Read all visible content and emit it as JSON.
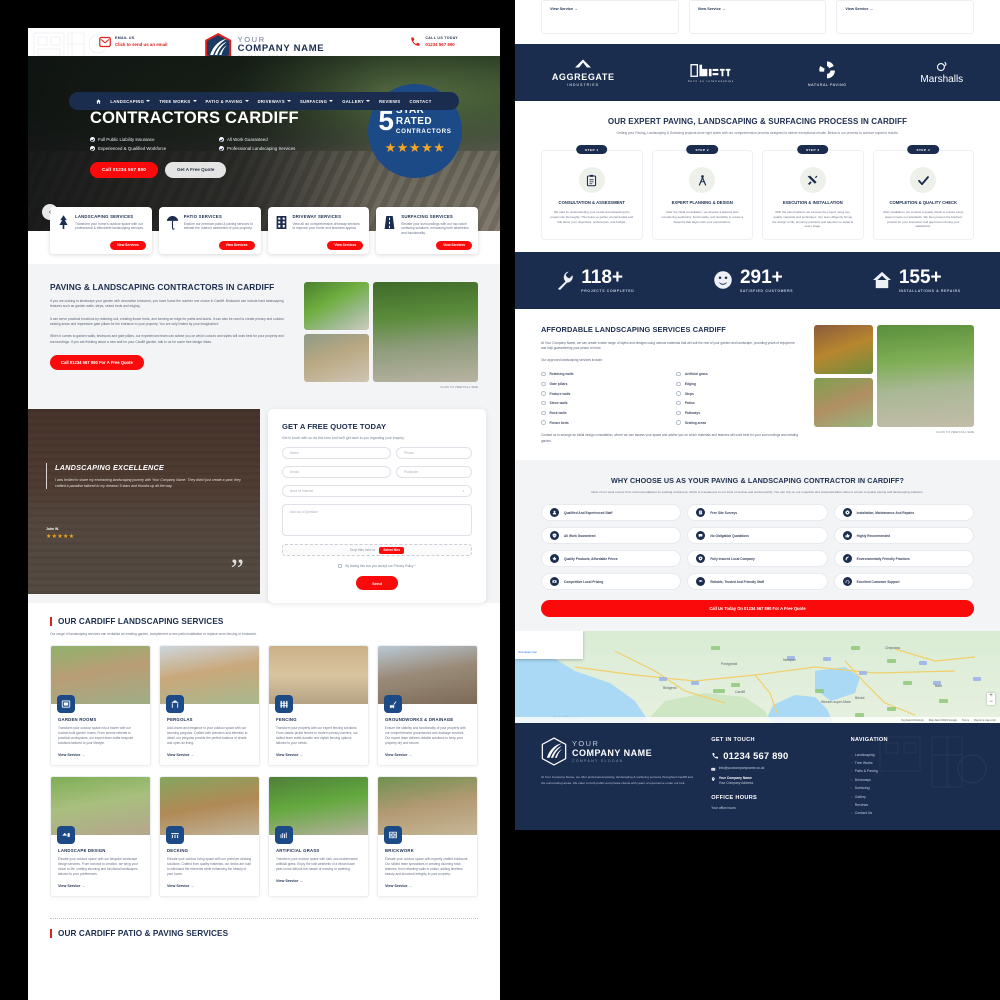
{
  "brand": {
    "name_line1": "YOUR",
    "name_line2": "COMPANY NAME",
    "slogan": "COMPANY SLOGAN",
    "accent_red": "#e2211c",
    "accent_navy": "#1b2d4f",
    "button_red": "#fa0a0a"
  },
  "topbar": {
    "email_label": "EMAIL US",
    "email_value": "Click to send us an email",
    "call_label": "CALL US TODAY",
    "call_value": "01234 567 890",
    "email_icon": "envelope-icon",
    "phone_icon": "phone-icon"
  },
  "nav": {
    "home_icon": "home-icon",
    "items": [
      {
        "label": "LANDSCAPING",
        "caret": true
      },
      {
        "label": "TREE WORKS",
        "caret": true
      },
      {
        "label": "PATIO & PAVING",
        "caret": true
      },
      {
        "label": "DRIVEWAYS",
        "caret": true
      },
      {
        "label": "SURFACING",
        "caret": true
      },
      {
        "label": "GALLERY",
        "caret": true
      },
      {
        "label": "REVIEWS",
        "caret": false
      },
      {
        "label": "CONTACT",
        "caret": false
      }
    ]
  },
  "hero": {
    "title": "LANDSCAPING CONTRACTORS CARDIFF",
    "ticks": [
      "Full Public Liability Insurance",
      "All Work Guaranteed",
      "Experienced & Qualified Workforce",
      "Professional Landscaping Services"
    ],
    "cta_primary": "Call 01234 567 890",
    "cta_secondary": "Get A Free Quote",
    "badge": {
      "number": "5",
      "line1": "STAR",
      "line2": "RATED",
      "line3": "CONTRACTORS",
      "stars": "★★★★★"
    },
    "prev_arrow": "‹"
  },
  "service_strip": [
    {
      "icon": "tree-icon",
      "title": "LANDSCAPING SERVICES",
      "text": "Transform your home's outdoor space with our professional & affordable landscaping services.",
      "button": "View Services"
    },
    {
      "icon": "parasol-icon",
      "title": "PATIO SERVICES",
      "text": "Explore our premium patio & paving services to elevate the outdoor aesthetics of your property.",
      "button": "View Services"
    },
    {
      "icon": "building-icon",
      "title": "DRIVEWAY SERVICES",
      "text": "View all our comprehensive driveway services to improve your home and business appeal.",
      "button": "View Services"
    },
    {
      "icon": "road-icon",
      "title": "SURFACING SERVICES",
      "text": "Elevate your surroundings with our top-notch surfacing solutions, enhancing both aesthetics and functionality.",
      "button": "View Services"
    }
  ],
  "paving": {
    "title": "PAVING & LANDSCAPING CONTRACTORS IN CARDIFF",
    "p1": "If you are looking to landscape your garden with decorative brickwork, you have found the number one choice in Cardiff. Brickwork can include hard landscaping features such as garden walls, steps, raised beds and edging.",
    "p2": "It can serve practical functions by retaining soil, creating flower beds, and forming an edge for paths and lawns. It can also be used to create privacy and outdoor seating areas and impressive gate pillars for the entrance to your property. You are only limited by your imagination!",
    "p3": "When it comes to garden walls, brickwork and gate pillars, our experienced team can advise you on which colours and styles will work best for your property and surroundings. If you are thinking about a new wall for your Cardiff garden, talk to us for some free design ideas.",
    "cta": "Call 01234 567 890 For A Free Quote",
    "gallery_caption": "CLICK TO VIEW FULL SIZE"
  },
  "testimonial": {
    "heading": "LANDSCAPING EXCELLENCE",
    "quote": "I was thrilled to share my enchanting landscaping journey with Your Company Name. They didn't just create a yard; they crafted a paradise tailored to my dreams! 5 stars and thumbs up all the way.",
    "author": "John W.",
    "stars": "★★★★★",
    "quote_glyph": "”"
  },
  "quote_form": {
    "title": "GET A FREE QUOTE TODAY",
    "subtitle": "Get in touch with us via this form and we'll get back to you regarding your enquiry.",
    "name_placeholder": "Name",
    "phone_placeholder": "Phone",
    "email_placeholder": "Email",
    "postcode_placeholder": "Postcode",
    "area_placeholder": "Area of Interest",
    "question_placeholder": "Ask Us a Question",
    "drop_text": "Drop files here or",
    "select_files": "Select files",
    "privacy_text": "By ticking this box you accept our Privacy Policy *",
    "send_label": "Send"
  },
  "landscaping_section": {
    "title": "OUR CARDIFF LANDSCAPING SERVICES",
    "lead": "Our range of landscaping services can revitalise an existing garden, complement a new patio installation or replace worn fencing or brickwork.",
    "view_label": "View Service",
    "cards": [
      {
        "icon": "garden-room-icon",
        "thumb": "t-gardenroom",
        "title": "GARDEN ROOMS",
        "text": "Transform your outdoor space into a haven with our custom-built garden rooms. From serene retreats to practical workspaces, our expert team crafts bespoke solutions tailored to your lifestyle."
      },
      {
        "icon": "pergola-icon",
        "thumb": "t-pergola",
        "title": "PERGOLAS",
        "text": "Add charm and elegance to your outdoor space with our stunning pergolas. Crafted with precision and attention to detail, our pergolas provide the perfect balance of shade and open-air living."
      },
      {
        "icon": "fence-icon",
        "thumb": "t-fencing",
        "title": "FENCING",
        "text": "Transform your property with our expert fencing solutions. From classic picket fences to modern privacy barriers, our skilled team crafts durable and stylish fencing options tailored to your needs."
      },
      {
        "icon": "excavator-icon",
        "thumb": "t-ground",
        "title": "GROUNDWORKS & DRAINAGE",
        "text": "Ensure the stability and functionality of your property with our comprehensive groundworks and drainage services. Our expert team delivers reliable solutions to keep your property dry and secure."
      },
      {
        "icon": "landscape-design-icon",
        "thumb": "t-design",
        "title": "LANDSCAPE DESIGN",
        "text": "Elevate your outdoor space with our bespoke landscape design services. From concept to creation, we bring your vision to life, crafting stunning and functional landscapes tailored to your preferences."
      },
      {
        "icon": "decking-icon",
        "thumb": "t-decking",
        "title": "DECKING",
        "text": "Elevate your outdoor living space with our premium decking solutions. Crafted from quality materials, our decks are built to withstand the elements while enhancing the beauty of your home."
      },
      {
        "icon": "grass-icon",
        "thumb": "t-grass",
        "title": "ARTIFICIAL GRASS",
        "text": "Transform your outdoor space with lush, low-maintenance artificial grass. Enjoy the lush aesthetic of a vibrant lawn year-round without the hassle of mowing or watering."
      },
      {
        "icon": "brick-icon",
        "thumb": "t-brick",
        "title": "BRICKWORK",
        "text": "Elevate your outdoor space with expertly crafted brickwork. Our skilled team specialises in creating stunning brick features, from retaining walls to patios, adding timeless beauty and structural integrity to your property."
      }
    ]
  },
  "patio_section": {
    "title": "OUR CARDIFF PATIO & PAVING SERVICES"
  },
  "right_topcards": {
    "view_label": "View Service"
  },
  "brands": [
    {
      "name": "AGGREGATE",
      "sub": "INDUSTRIES",
      "icon": "aggregate-logo"
    },
    {
      "name": "BrEtt",
      "sub": "built on relationships",
      "icon": "brett-logo"
    },
    {
      "name": "NATURAL PAVING",
      "sub": "be inspired",
      "icon": "natural-paving-logo"
    },
    {
      "name": "Marshalls",
      "sub": "",
      "icon": "marshalls-logo"
    }
  ],
  "process": {
    "title": "OUR EXPERT PAVING, LANDSCAPING & SURFACING PROCESS IN CARDIFF",
    "lead": "Getting your Paving, Landscaping & Surfacing projects done right starts with our comprehensive process designed to deliver exceptional results. Below is our process to achieve superior results.",
    "steps": [
      {
        "pill": "STEP 1",
        "icon": "clipboard-icon",
        "title": "CONSULTATION & ASSESSMENT",
        "text": "We start by understanding your needs and assessing the project site thoroughly. This helps us gather crucial details and talk about your objectives, preferences, and budget."
      },
      {
        "pill": "STEP 2",
        "icon": "compass-icon",
        "title": "EXPERT PLANNING & DESIGN",
        "text": "After the initial consultation, we develop a tailored plan considering aesthetics, functionality, and durability to create a blueprint that aligns with your expectations."
      },
      {
        "pill": "STEP 3",
        "icon": "tools-icon",
        "title": "EXECUTION & INSTALLATION",
        "text": "With the plan finalised, we execute the project using top-quality materials and techniques. Our team diligently brings the design to life, ensuring precision and attention to detail at every stage."
      },
      {
        "pill": "STEP 4",
        "icon": "check-icon",
        "title": "COMPLETION & QUALITY CHECK",
        "text": "After installation, we conduct a quality check to ensure every aspect meets our standards. We then present the finished product for your inspection and approval ensuring your satisfaction."
      }
    ]
  },
  "stats": [
    {
      "icon": "wrench-icon",
      "number": "118+",
      "label": "PROJECTS COMPLETED"
    },
    {
      "icon": "smiley-icon",
      "number": "291+",
      "label": "SATISFIED CUSTOMERS"
    },
    {
      "icon": "house-icon",
      "number": "155+",
      "label": "INSTALLATIONS & REPAIRS"
    }
  ],
  "afford": {
    "title": "AFFORDABLE LANDSCAPING SERVICES CARDIFF",
    "p1": "At Your Company Name, we can create a wide range of styles and designs using various materials that will suit the rest of your garden and landscape, providing years of enjoyment and fully guaranteeing your peace of mind.",
    "p2": "Our approved landscaping services include:",
    "list_left": [
      "Retaining walls",
      "Gate pillars",
      "Feature walls",
      "Stone walls",
      "Rock walls",
      "Flower beds"
    ],
    "list_right": [
      "Artificial grass",
      "Edging",
      "Steps",
      "Patios",
      "Pathways",
      "Seating areas"
    ],
    "p3": "Contact us to arrange an initial design consultation, where we can assess your space and advise you on which materials and features will work best for your surroundings and existing garden.",
    "gallery_caption": "CLICK TO VIEW FULL SIZE"
  },
  "why": {
    "title": "WHY CHOOSE US AS YOUR PAVING & LANDSCAPING CONTRACTOR IN CARDIFF?",
    "lead": "Most of our work comes from recommendations by existing customers, which is a testament to our level of service and workmanship. You can rely on our expertise and professionalism when it comes to quality paving and landscaping solutions.",
    "items": [
      {
        "icon": "staff-icon",
        "label": "Qualified And Experienced Staff"
      },
      {
        "icon": "survey-icon",
        "label": "Free Site Surveys"
      },
      {
        "icon": "repair-icon",
        "label": "Installation, Maintenance And Repairs"
      },
      {
        "icon": "guarantee-icon",
        "label": "All Work Guaranteed"
      },
      {
        "icon": "quote-icon",
        "label": "No Obligation Quotations"
      },
      {
        "icon": "thumb-icon",
        "label": "Highly Recommended"
      },
      {
        "icon": "quality-icon",
        "label": "Quality Products, Affordable Prices"
      },
      {
        "icon": "insured-icon",
        "label": "Fully Insured Local Company"
      },
      {
        "icon": "leaf-icon",
        "label": "Environmentally Friendly Practices"
      },
      {
        "icon": "pricing-icon",
        "label": "Competitive Local Pricing"
      },
      {
        "icon": "trust-icon",
        "label": "Reliable, Trusted And Friendly Staff"
      },
      {
        "icon": "support-icon",
        "label": "Excellent Customer Support"
      }
    ],
    "cta": "Call Us Today On 01234 567 890 For A Free Quote"
  },
  "map": {
    "labels": [
      "Cardiff",
      "Newport",
      "Bristol",
      "Bridgend",
      "Bath",
      "Pontypridd",
      "Clevedon",
      "Weston-super-Mare",
      "Barry",
      "Caerphilly",
      "Chepstow",
      "Severn Beach",
      "Portishead",
      "Nailsea",
      "Bristol Channel"
    ],
    "zoom_in": "+",
    "zoom_out": "−",
    "attribution": "Map data ©2024 Google",
    "terms": "Terms",
    "report": "Report a map error",
    "shortcuts": "Keyboard shortcuts",
    "card_link": "View larger map"
  },
  "footer": {
    "about": "At Your Company Name, we offer professional paving, landscaping & surfacing services throughout Cardiff and the surrounding areas. We cater to both public and private clients with years of experience under our belt.",
    "contact_heading": "GET IN TOUCH",
    "phone": "01234 567 890",
    "email": "info@yourcompanyname.co.uk",
    "address_line1": "Your Company Name",
    "address_line2": "Your Company Address",
    "hours_heading": "OFFICE HOURS",
    "hours_value": "Your office hours",
    "nav_heading": "NAVIGATION",
    "nav_items": [
      "Landscaping",
      "Tree Works",
      "Patio & Paving",
      "Driveways",
      "Surfacing",
      "Gallery",
      "Reviews",
      "Contact Us"
    ]
  }
}
